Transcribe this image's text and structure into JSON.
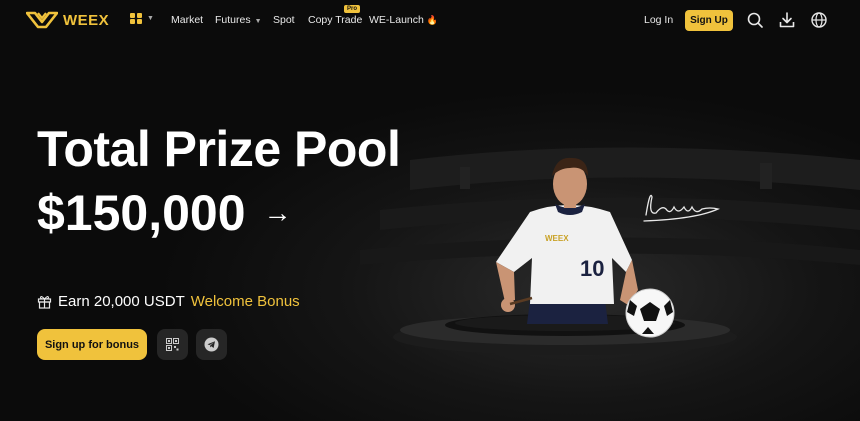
{
  "brand": {
    "name": "WEEX",
    "accent": "#f0c23c"
  },
  "nav": {
    "items": [
      {
        "label": "Market"
      },
      {
        "label": "Futures"
      },
      {
        "label": "Spot"
      },
      {
        "label": "Copy Trade",
        "badge": "Pro"
      },
      {
        "label": "WE-Launch"
      }
    ],
    "login": "Log In",
    "signup": "Sign Up",
    "icons": [
      "apps-grid-icon",
      "search-icon",
      "download-icon",
      "globe-icon"
    ]
  },
  "hero": {
    "title": "Total Prize Pool",
    "amount": "$150,000",
    "bonus_prefix": "Earn 20,000 USDT",
    "bonus_highlight": "Welcome Bonus",
    "cta": "Sign up for bonus",
    "jersey_text": "WEEX",
    "jersey_number": "10"
  }
}
